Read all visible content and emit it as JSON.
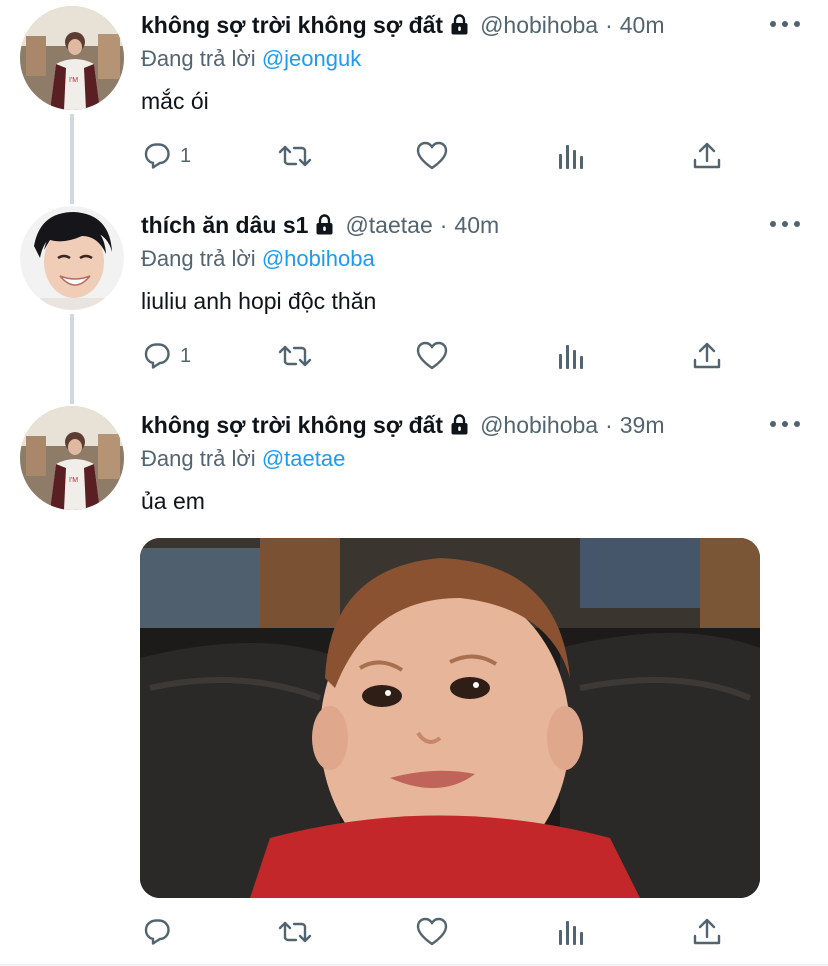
{
  "colors": {
    "accent": "#1d9bf0",
    "text": "#0f1419",
    "secondary": "#536471",
    "thread_line": "#cfd9de"
  },
  "tweets": [
    {
      "name": "không sợ trời không sợ đất",
      "locked": true,
      "handle": "@hobihoba",
      "dot": "·",
      "time": "40m",
      "reply_prefix": "Đang trả lời ",
      "reply_to": "@jeonguk",
      "text": "mắc ói",
      "reply_count": "1",
      "icons": [
        "reply-icon",
        "retweet-icon",
        "like-icon",
        "analytics-icon",
        "share-icon"
      ]
    },
    {
      "name": "thích ăn dâu s1",
      "locked": true,
      "handle": "@taetae",
      "dot": "·",
      "time": "40m",
      "reply_prefix": "Đang trả lời ",
      "reply_to": "@hobihoba",
      "text": "liuliu anh hopi độc thăn",
      "reply_count": "1",
      "icons": [
        "reply-icon",
        "retweet-icon",
        "like-icon",
        "analytics-icon",
        "share-icon"
      ]
    },
    {
      "name": "không sợ trời không sợ đất",
      "locked": true,
      "handle": "@hobihoba",
      "dot": "·",
      "time": "39m",
      "reply_prefix": "Đang trả lời ",
      "reply_to": "@taetae",
      "text": "ủa em",
      "reply_count": "",
      "has_media": true,
      "icons": [
        "reply-icon",
        "retweet-icon",
        "like-icon",
        "analytics-icon",
        "share-icon"
      ]
    }
  ]
}
